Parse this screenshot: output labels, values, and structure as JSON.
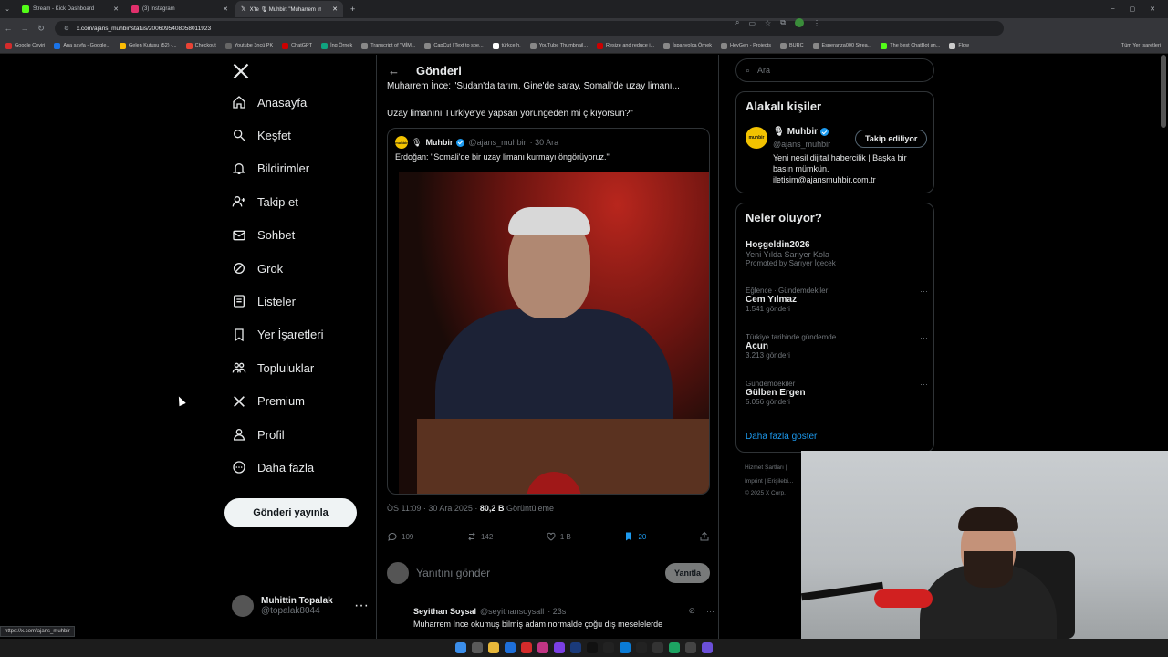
{
  "browser": {
    "tabs": [
      {
        "label": "Stream - Kick Dashboard",
        "color": "#53fc18"
      },
      {
        "label": "(3) Instagram",
        "color": "#e1306c"
      },
      {
        "label": "X'te 🎙 Muhbir: \"Muharrem İn...",
        "color": "#ffffff"
      }
    ],
    "url": "x.com/ajans_muhbir/status/2006095408058011923",
    "bookmarks": [
      "Google Çeviri",
      "Ana sayfa - Google...",
      "Gelen Kutusu (52) -...",
      "Checkout",
      "Youtube 3ncü PK",
      "ChatGPT",
      "İng Örnek",
      "Transcript of \"MİM...",
      "CapCut | Text to spe...",
      "türkçe h.",
      "YouTube Thumbnail...",
      "Resize and reduce i...",
      "İspanyolca Örnek",
      "HeyGen - Projects",
      "BURÇ",
      "Esperanza000 Strea...",
      "The best ChatBot an...",
      "Flow"
    ],
    "all_bookmarks": "Tüm Yer İşaretleri",
    "status_url": "https://x.com/ajans_muhbir"
  },
  "nav": {
    "items": [
      "Anasayfa",
      "Keşfet",
      "Bildirimler",
      "Takip et",
      "Sohbet",
      "Grok",
      "Listeler",
      "Yer İşaretleri",
      "Topluluklar",
      "Premium",
      "Profil",
      "Daha fazla"
    ],
    "post_button": "Gönderi yayınla",
    "account_name": "Muhittin Topalak",
    "account_handle": "@topalak8044"
  },
  "post": {
    "header": "Gönderi",
    "line1": "Muharrem İnce: \"Sudan'da tarım, Gine'de saray, Somali'de uzay limanı...",
    "line2": "Uzay limanını Türkiye'ye yapsan yörüngeden mi çıkıyorsun?\"",
    "quote_name": "Muhbir",
    "quote_handle": "@ajans_muhbir",
    "quote_date": "· 30 Ara",
    "quote_text": "Erdoğan: \"Somali'de bir uzay limanı kurmayı öngörüyoruz.\"",
    "time": "ÖS 11:09 · 30 Ara 2025 ·",
    "views": "80,2 B",
    "views_label": "Görüntüleme",
    "replies": "109",
    "reposts": "142",
    "likes": "1 B",
    "bookmarks": "20",
    "reply_placeholder": "Yanıtını gönder",
    "reply_button": "Yanıtla",
    "comment_name": "Seyithan Soysal",
    "comment_handle": "@seyithansoysall",
    "comment_time": "· 23s",
    "comment_text": "Muharrem İnce okumuş bilmiş adam normalde çoğu dış meselelerde"
  },
  "sidebar": {
    "search_placeholder": "Ara",
    "related_title": "Alakalı kişiler",
    "person_name": "Muhbir",
    "person_handle": "@ajans_muhbir",
    "follow_label": "Takip ediliyor",
    "bio": "Yeni nesil dijital habercilik | Başka bir basın mümkün. iletisim@ajansmuhbir.com.tr",
    "trends_title": "Neler oluyor?",
    "trends": [
      {
        "cat": "",
        "title": "Hoşgeldin2026",
        "sub": "Yeni Yılda Sarıyer Kola",
        "count": "Promoted by Sarıyer İçecek"
      },
      {
        "cat": "Eğlence · Gündemdekiler",
        "title": "Cem Yılmaz",
        "sub": "",
        "count": "1.541 gönderi"
      },
      {
        "cat": "Türkiye tarihinde gündemde",
        "title": "Acun",
        "sub": "",
        "count": "3.213 gönderi"
      },
      {
        "cat": "Gündemdekiler",
        "title": "Gülben Ergen",
        "sub": "",
        "count": "5.056 gönderi"
      }
    ],
    "show_more": "Daha fazla göster",
    "footer1": "Hizmet Şartları |",
    "footer2": "Imprint | Erişilebi...",
    "footer3": "© 2025 X Corp."
  },
  "colors": {
    "accent": "#1d9bf0",
    "brand_yellow": "#f2c200"
  }
}
